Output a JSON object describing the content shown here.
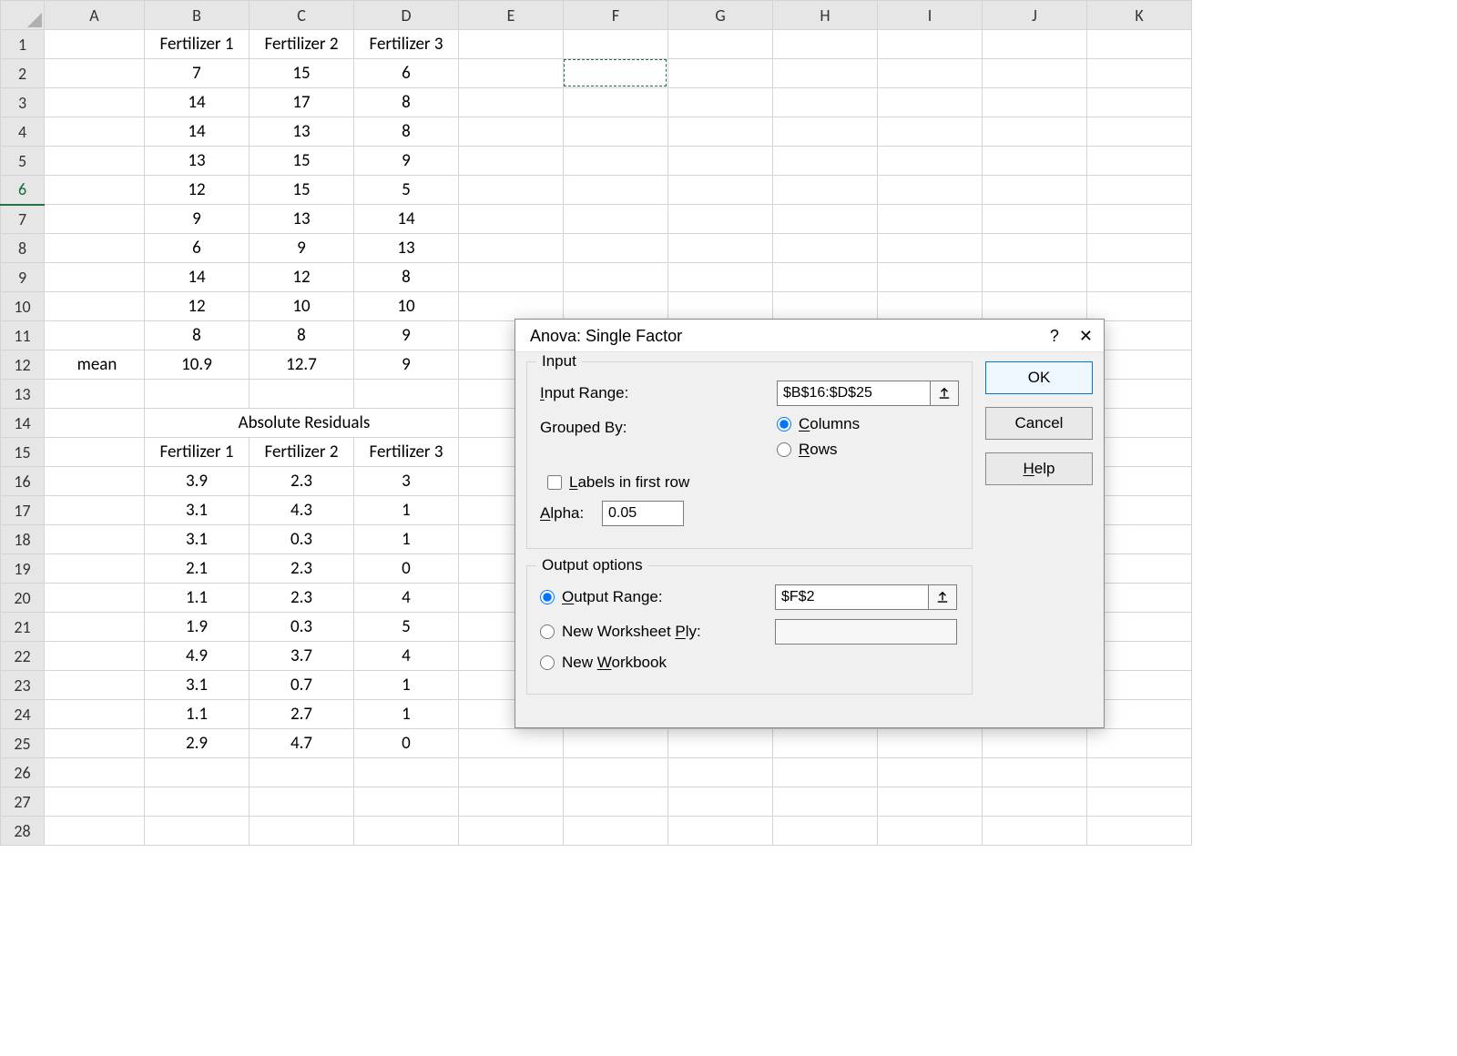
{
  "columns": [
    "A",
    "B",
    "C",
    "D",
    "E",
    "F",
    "G",
    "H",
    "I",
    "J",
    "K"
  ],
  "rowCount": 28,
  "cells": {
    "1": {
      "B": "Fertilizer 1",
      "C": "Fertilizer 2",
      "D": "Fertilizer 3",
      "_bold": [
        "B",
        "C",
        "D"
      ]
    },
    "2": {
      "B": "7",
      "C": "15",
      "D": "6"
    },
    "3": {
      "B": "14",
      "C": "17",
      "D": "8"
    },
    "4": {
      "B": "14",
      "C": "13",
      "D": "8"
    },
    "5": {
      "B": "13",
      "C": "15",
      "D": "9"
    },
    "6": {
      "B": "12",
      "C": "15",
      "D": "5"
    },
    "7": {
      "B": "9",
      "C": "13",
      "D": "14"
    },
    "8": {
      "B": "6",
      "C": "9",
      "D": "13"
    },
    "9": {
      "B": "14",
      "C": "12",
      "D": "8"
    },
    "10": {
      "B": "12",
      "C": "10",
      "D": "10"
    },
    "11": {
      "B": "8",
      "C": "8",
      "D": "9"
    },
    "12": {
      "A": "mean",
      "B": "10.9",
      "C": "12.7",
      "D": "9",
      "_bold": [
        "A",
        "B",
        "C",
        "D"
      ],
      "_left": [
        "A"
      ]
    },
    "14": {
      "B": "Absolute Residuals",
      "_left": [
        "B"
      ],
      "_span": {
        "B": 3
      }
    },
    "15": {
      "B": "Fertilizer 1",
      "C": "Fertilizer 2",
      "D": "Fertilizer 3",
      "_bold": [
        "B",
        "C",
        "D"
      ]
    },
    "16": {
      "B": "3.9",
      "C": "2.3",
      "D": "3"
    },
    "17": {
      "B": "3.1",
      "C": "4.3",
      "D": "1"
    },
    "18": {
      "B": "3.1",
      "C": "0.3",
      "D": "1"
    },
    "19": {
      "B": "2.1",
      "C": "2.3",
      "D": "0"
    },
    "20": {
      "B": "1.1",
      "C": "2.3",
      "D": "4"
    },
    "21": {
      "B": "1.9",
      "C": "0.3",
      "D": "5"
    },
    "22": {
      "B": "4.9",
      "C": "3.7",
      "D": "4"
    },
    "23": {
      "B": "3.1",
      "C": "0.7",
      "D": "1"
    },
    "24": {
      "B": "1.1",
      "C": "2.7",
      "D": "1"
    },
    "25": {
      "B": "2.9",
      "C": "4.7",
      "D": "0"
    }
  },
  "selectedRow": 6,
  "marquee": {
    "col": "F",
    "row": 2
  },
  "dialog": {
    "title": "Anova: Single Factor",
    "help_icon": "?",
    "close_icon": "✕",
    "input": {
      "legend": "Input",
      "input_range_label": "Input Range:",
      "input_range_value": "$B$16:$D$25",
      "grouped_by_label": "Grouped By:",
      "opt_columns": "Columns",
      "opt_rows": "Rows",
      "labels_first_row": "Labels in first row",
      "alpha_label": "Alpha:",
      "alpha_value": "0.05"
    },
    "output": {
      "legend": "Output options",
      "output_range_label": "Output Range:",
      "output_range_value": "$F$2",
      "new_ws_ply": "New Worksheet Ply:",
      "new_workbook": "New Workbook"
    },
    "buttons": {
      "ok": "OK",
      "cancel": "Cancel",
      "help": "Help"
    }
  },
  "colWidths": {
    "_row": 48,
    "A": 110,
    "B": 115,
    "C": 115,
    "D": 115,
    "E": 115,
    "F": 115,
    "G": 115,
    "H": 115,
    "I": 115,
    "J": 115,
    "K": 115
  }
}
